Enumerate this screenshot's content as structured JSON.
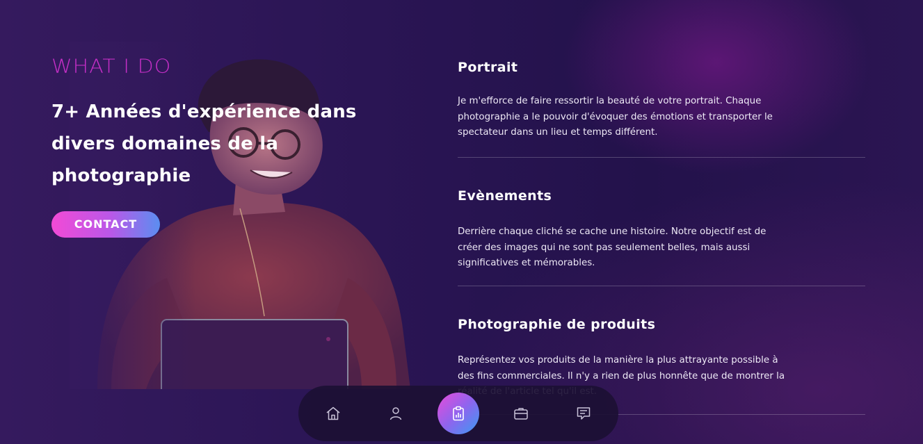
{
  "hero": {
    "eyebrow": "WHAT I DO",
    "headline": "7+ Années d'expérience dans divers domaines de la photographie",
    "contact_label": "CONTACT"
  },
  "services": [
    {
      "title": "Portrait",
      "description": "Je m'efforce de faire ressortir la beauté de votre portrait. Chaque photographie a le pouvoir d'évoquer des émotions et transporter le spectateur dans un lieu et temps différent."
    },
    {
      "title": "Evènements",
      "description": "Derrière chaque cliché se cache une histoire. Notre objectif est de créer des images qui ne sont pas seulement belles, mais aussi significatives et mémorables."
    },
    {
      "title": "Photographie de produits",
      "description": "Représentez vos produits de la manière la plus attrayante possible à des fins commerciales. Il n'y a rien de plus honnête que de montrer la réalité de l'article tel qu'il est."
    }
  ],
  "nav": {
    "items": [
      {
        "icon": "home-icon",
        "active": false
      },
      {
        "icon": "user-icon",
        "active": false
      },
      {
        "icon": "clipboard-chart-icon",
        "active": true
      },
      {
        "icon": "briefcase-icon",
        "active": false
      },
      {
        "icon": "message-icon",
        "active": false
      }
    ]
  },
  "colors": {
    "accent_magenta": "#c42fc6",
    "button_gradient_start": "#f24ad6",
    "button_gradient_end": "#5b8ef0",
    "background": "#2a1554"
  }
}
